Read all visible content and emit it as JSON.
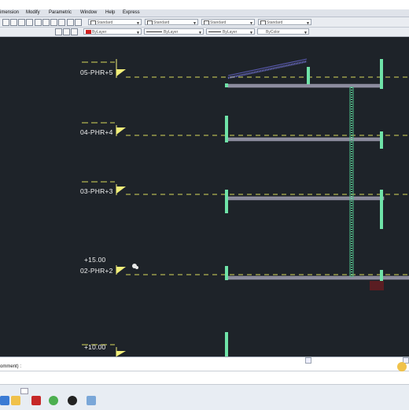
{
  "menu": {
    "items": [
      "imension",
      "Modify",
      "Parametric",
      "Window",
      "Help",
      "Express"
    ]
  },
  "toolbar": {
    "styles": [
      "Standard",
      "Standard",
      "Standard",
      "Standard"
    ],
    "properties": [
      "ByLayer",
      "ByLayer",
      "ByLayer",
      "ByColor"
    ]
  },
  "drawing": {
    "levels": [
      {
        "name": "05-PHR+5",
        "elevation": ""
      },
      {
        "name": "04-PHR+4",
        "elevation": ""
      },
      {
        "name": "03-PHR+3",
        "elevation": ""
      },
      {
        "name": "02-PHR+2",
        "elevation": "+15.00"
      },
      {
        "name": "",
        "elevation": "+10.00"
      }
    ]
  },
  "command": {
    "text": "omment) :"
  },
  "colors": {
    "canvas_bg": "#1e2329",
    "level_line": "#d8d85a",
    "column": "#6fe3a8",
    "slab": "#8a8a9c",
    "flag": "#f2ef7a"
  }
}
